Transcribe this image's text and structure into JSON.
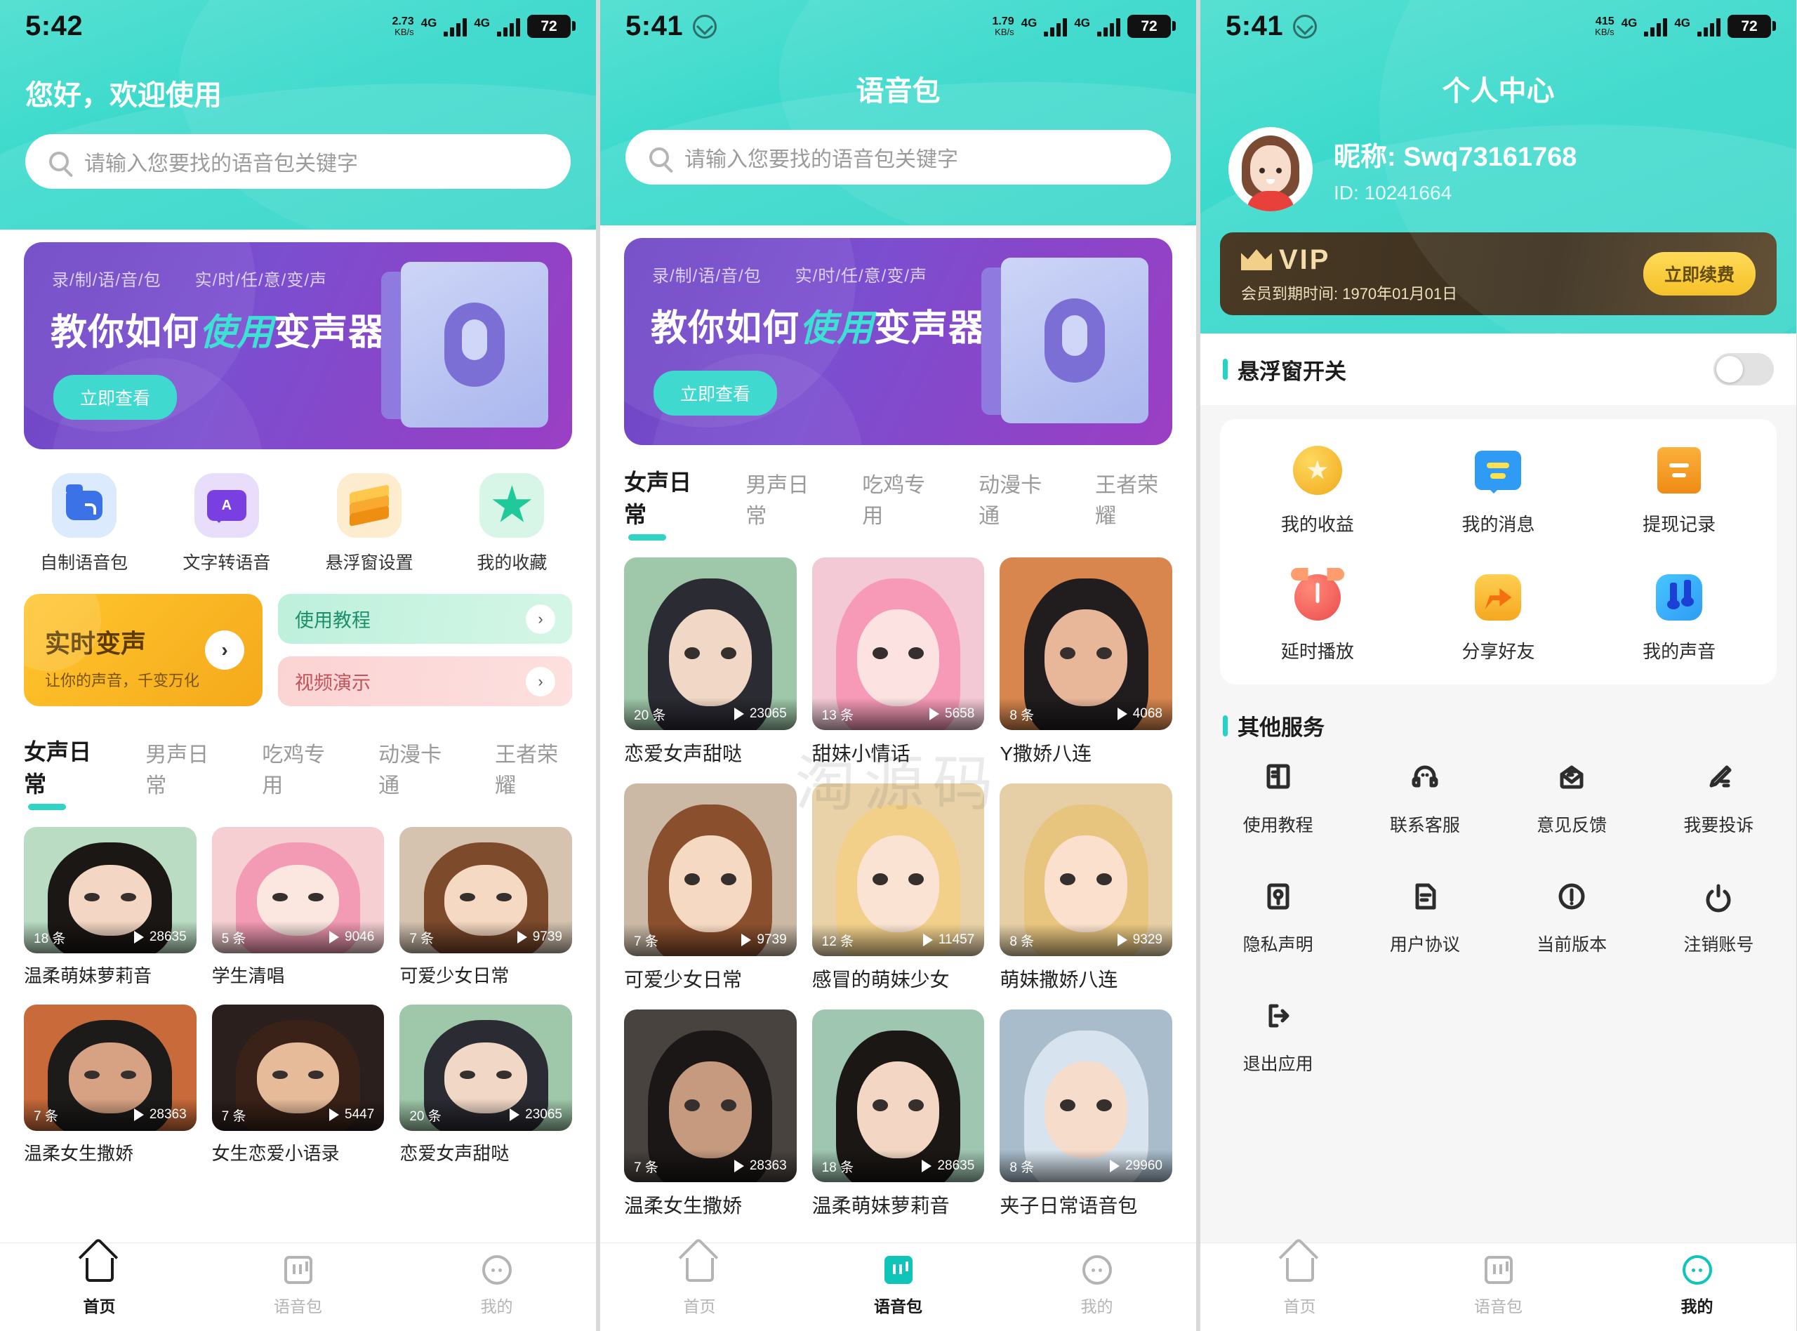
{
  "status_bars": [
    {
      "time": "5:42",
      "net_speed": "2.73",
      "net_unit": "KB/s",
      "g1": "4G",
      "g2": "4G",
      "battery": "72",
      "has_weather_icon": false
    },
    {
      "time": "5:41",
      "net_speed": "1.79",
      "net_unit": "KB/s",
      "g1": "4G",
      "g2": "4G",
      "battery": "72",
      "has_weather_icon": true
    },
    {
      "time": "5:41",
      "net_speed": "415",
      "net_unit": "KB/s",
      "g1": "4G",
      "g2": "4G",
      "battery": "72",
      "has_weather_icon": true
    }
  ],
  "colors": {
    "teal": "#2ad3c6",
    "accent": "#2fd4c6",
    "banner_purple": "#7b4ed0",
    "yellow": "#ffc62e",
    "vip_gold": "#f4dcab"
  },
  "screen1": {
    "greeting": "您好，欢迎使用",
    "search_placeholder": "请输入您要找的语音包关键字",
    "banner": {
      "tag_left": "录/制/语/音/包",
      "tag_right": "实/时/任/意/变/声",
      "title_plain_1": "教你如何",
      "title_em": "使用",
      "title_plain_2": "变声器",
      "button": "立即查看"
    },
    "quick_actions": [
      {
        "label": "自制语音包",
        "icon": "folder-sound-icon"
      },
      {
        "label": "文字转语音",
        "icon": "text-to-speech-icon"
      },
      {
        "label": "悬浮窗设置",
        "icon": "layers-icon"
      },
      {
        "label": "我的收藏",
        "icon": "star-icon"
      }
    ],
    "realtime_card": {
      "title": "实时变声",
      "subtitle": "让你的声音，千变万化",
      "arrow": "›"
    },
    "side_cards": [
      {
        "label": "使用教程",
        "arrow": "›"
      },
      {
        "label": "视频演示",
        "arrow": "›"
      }
    ],
    "tabs": [
      "女声日常",
      "男声日常",
      "吃鸡专用",
      "动漫卡通",
      "王者荣耀"
    ],
    "active_tab": 0,
    "packs": [
      {
        "name": "温柔萌妹萝莉音",
        "count": "18 条",
        "plays": "28635",
        "bg": "#b9dcc3",
        "hair": "#1b1714",
        "face": "#f3d6c3"
      },
      {
        "name": "学生清唱",
        "count": "5 条",
        "plays": "9046",
        "bg": "#f6cfd2",
        "hair": "#f39ab4",
        "face": "#fbe6e0"
      },
      {
        "name": "可爱少女日常",
        "count": "7 条",
        "plays": "9739",
        "bg": "#d5c3b0",
        "hair": "#7d4a2c",
        "face": "#f6d9c2"
      },
      {
        "name": "温柔女生撒娇",
        "count": "7 条",
        "plays": "28363",
        "bg": "#c96a3a",
        "hair": "#1d1b1a",
        "face": "#d7a283"
      },
      {
        "name": "女生恋爱小语录",
        "count": "7 条",
        "plays": "5447",
        "bg": "#2a1f1c",
        "hair": "#3a2218",
        "face": "#e6bb9a"
      },
      {
        "name": "恋爱女声甜哒",
        "count": "20 条",
        "plays": "23065",
        "bg": "#9ec8a9",
        "hair": "#2b2b33",
        "face": "#f1d7c5"
      }
    ],
    "nav": [
      {
        "label": "首页",
        "icon": "home-icon",
        "active": true
      },
      {
        "label": "语音包",
        "icon": "voice-pack-icon",
        "active": false
      },
      {
        "label": "我的",
        "icon": "profile-icon",
        "active": false
      }
    ]
  },
  "screen2": {
    "title": "语音包",
    "search_placeholder": "请输入您要找的语音包关键字",
    "banner": {
      "tag_left": "录/制/语/音/包",
      "tag_right": "实/时/任/意/变/声",
      "title_plain_1": "教你如何",
      "title_em": "使用",
      "title_plain_2": "变声器",
      "button": "立即查看"
    },
    "tabs": [
      "女声日常",
      "男声日常",
      "吃鸡专用",
      "动漫卡通",
      "王者荣耀"
    ],
    "active_tab": 0,
    "packs": [
      {
        "name": "恋爱女声甜哒",
        "count": "20 条",
        "plays": "23065",
        "bg": "#9ec8a9",
        "hair": "#2b2b33",
        "face": "#f1d7c5"
      },
      {
        "name": "甜妹小情话",
        "count": "13 条",
        "plays": "5658",
        "bg": "#f4c9d6",
        "hair": "#f79ab8",
        "face": "#fce3e2"
      },
      {
        "name": "Y撒娇八连",
        "count": "8 条",
        "plays": "4068",
        "bg": "#d9864e",
        "hair": "#211d1f",
        "face": "#e8b79a"
      },
      {
        "name": "可爱少女日常",
        "count": "7 条",
        "plays": "9739",
        "bg": "#cbb9a6",
        "hair": "#8a4f2d",
        "face": "#f6d9c2"
      },
      {
        "name": "感冒的萌妹少女",
        "count": "12 条",
        "plays": "11457",
        "bg": "#e9d2a7",
        "hair": "#f2d08a",
        "face": "#fae3d2"
      },
      {
        "name": "萌妹撒娇八连",
        "count": "8 条",
        "plays": "9329",
        "bg": "#e6cfa6",
        "hair": "#e8c57e",
        "face": "#fae0cd"
      },
      {
        "name": "温柔女生撒娇",
        "count": "7 条",
        "plays": "28363",
        "bg": "#49433f",
        "hair": "#1b1716",
        "face": "#c59a7e"
      },
      {
        "name": "温柔萌妹萝莉音",
        "count": "18 条",
        "plays": "28635",
        "bg": "#9fc6b1",
        "hair": "#1b1714",
        "face": "#f3d6c3"
      },
      {
        "name": "夹子日常语音包",
        "count": "8 条",
        "plays": "29960",
        "bg": "#a8bccb",
        "hair": "#d7e3ee",
        "face": "#f6dccb"
      }
    ],
    "nav": [
      {
        "label": "首页",
        "icon": "home-icon",
        "active": false
      },
      {
        "label": "语音包",
        "icon": "voice-pack-icon",
        "active": true
      },
      {
        "label": "我的",
        "icon": "profile-icon",
        "active": false
      }
    ]
  },
  "screen3": {
    "title": "个人中心",
    "profile": {
      "nickname_label": "昵称:",
      "nickname": "Swq73161768",
      "id_label": "ID:",
      "id": "10241664"
    },
    "vip": {
      "badge": "VIP",
      "expiry": "会员到期时间: 1970年01月01日",
      "renew_button": "立即续费"
    },
    "float_switch": {
      "label": "悬浮窗开关",
      "on": false
    },
    "features": [
      {
        "label": "我的收益",
        "icon": "coin-icon"
      },
      {
        "label": "我的消息",
        "icon": "message-icon"
      },
      {
        "label": "提现记录",
        "icon": "withdraw-record-icon"
      },
      {
        "label": "延时播放",
        "icon": "timer-icon"
      },
      {
        "label": "分享好友",
        "icon": "share-icon"
      },
      {
        "label": "我的声音",
        "icon": "music-note-icon"
      }
    ],
    "other_title": "其他服务",
    "other_services": [
      {
        "label": "使用教程",
        "icon": "book-icon"
      },
      {
        "label": "联系客服",
        "icon": "headset-icon"
      },
      {
        "label": "意见反馈",
        "icon": "envelope-icon"
      },
      {
        "label": "我要投诉",
        "icon": "pencil-icon"
      },
      {
        "label": "隐私声明",
        "icon": "key-icon"
      },
      {
        "label": "用户协议",
        "icon": "document-icon"
      },
      {
        "label": "当前版本",
        "icon": "info-icon"
      },
      {
        "label": "注销账号",
        "icon": "power-icon"
      },
      {
        "label": "退出应用",
        "icon": "logout-icon"
      }
    ],
    "nav": [
      {
        "label": "首页",
        "icon": "home-icon",
        "active": false
      },
      {
        "label": "语音包",
        "icon": "voice-pack-icon",
        "active": false
      },
      {
        "label": "我的",
        "icon": "profile-icon",
        "active": true
      }
    ]
  }
}
